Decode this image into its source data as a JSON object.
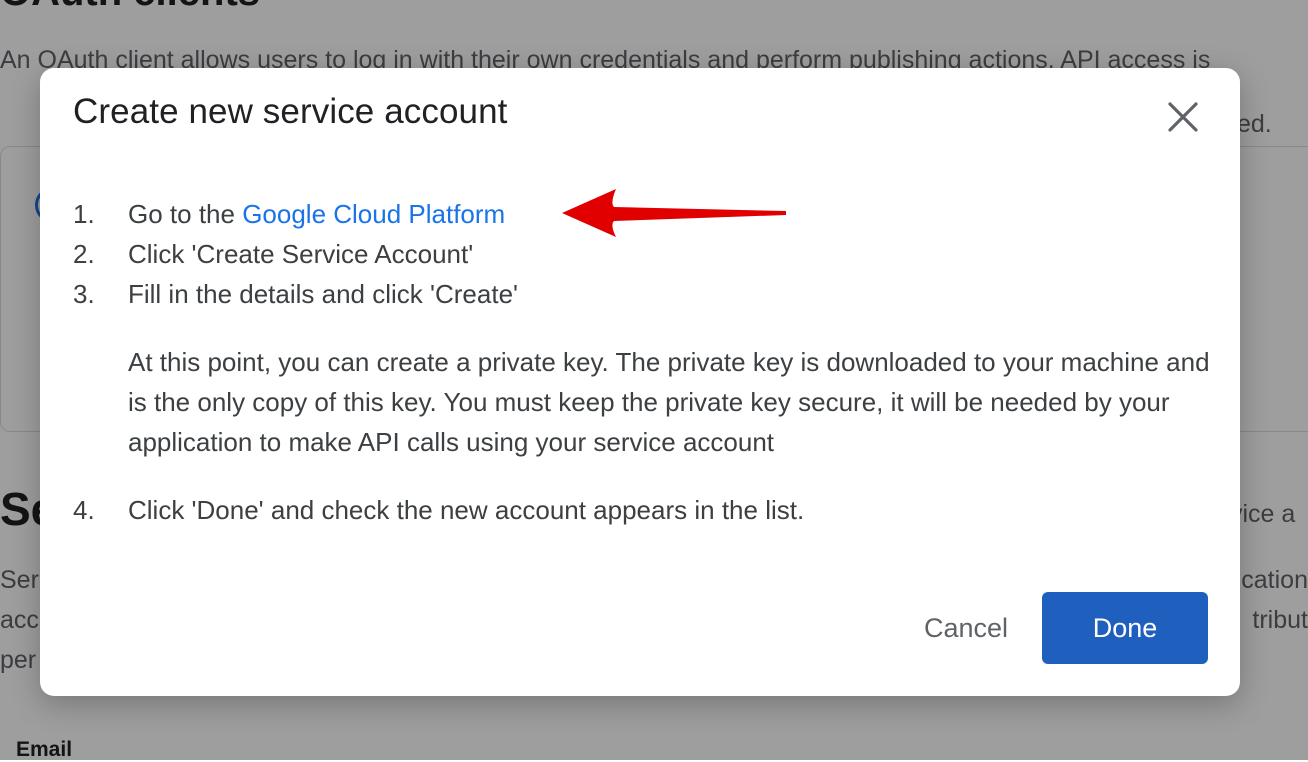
{
  "background": {
    "page_title": "OAuth clients",
    "description": "An OAuth client allows users to log in with their own credentials and perform publishing actions. API access is",
    "card_text_fragment": "ted.",
    "section_title": "Se",
    "section_right_fragment": "vice a",
    "section_desc_line1": "Ser",
    "section_desc_line1_right": "cation",
    "section_desc_line2": "acc",
    "section_desc_line2_right": "tribut",
    "section_desc_line3": "per",
    "email_label": "Email"
  },
  "dialog": {
    "title": "Create new service account",
    "steps": [
      {
        "num": "1.",
        "prefix": "Go to the ",
        "link": "Google Cloud Platform"
      },
      {
        "num": "2.",
        "text": "Click 'Create Service Account'"
      },
      {
        "num": "3.",
        "text": "Fill in the details and click 'Create'"
      },
      {
        "num": "4.",
        "text": "Click 'Done' and check the new account appears in the list."
      }
    ],
    "note": "At this point, you can create a private key. The private key is downloaded to your machine and is the only copy of this key. You must keep the private key secure, it will be needed by your application to make API calls using your service account",
    "cancel_label": "Cancel",
    "done_label": "Done"
  },
  "icons": {
    "close": "close-icon",
    "arrow": "red-arrow-annotation-icon"
  },
  "colors": {
    "link": "#1a73e8",
    "primary_button": "#1f5fbe",
    "annotation_arrow": "#e00000",
    "overlay": "rgba(0,0,0,0.38)"
  }
}
